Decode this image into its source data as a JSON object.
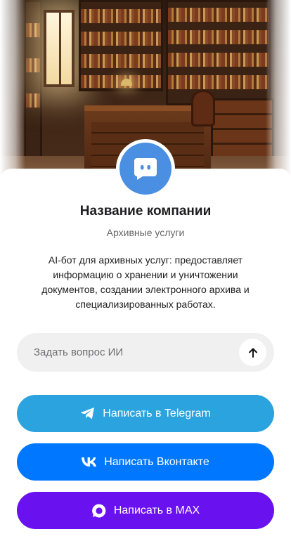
{
  "hero": {
    "icon": "library-photo"
  },
  "company": {
    "avatar_icon": "chat-bot-icon",
    "name": "Название компании",
    "subtitle": "Архивные услуги",
    "description": "AI-бот для архивных услуг: предоставляет информацию о хранении и уничтожении документов, создании электронного архива и специализированных работах."
  },
  "ask": {
    "placeholder": "Задать вопрос ИИ",
    "value": "",
    "send_icon": "arrow-up-icon"
  },
  "buttons": [
    {
      "label": "Написать в Telegram",
      "icon": "telegram-icon",
      "color": "#2aa3df"
    },
    {
      "label": "Написать Вконтакте",
      "icon": "vk-icon",
      "color": "#0077ff"
    },
    {
      "label": "Написать в MAX",
      "icon": "max-icon",
      "color": "#6a11f0"
    }
  ],
  "colors": {
    "avatar": "#4a8fe2",
    "input_bg": "#f0f0f0",
    "text": "#1d1d1f",
    "muted": "#666666"
  }
}
